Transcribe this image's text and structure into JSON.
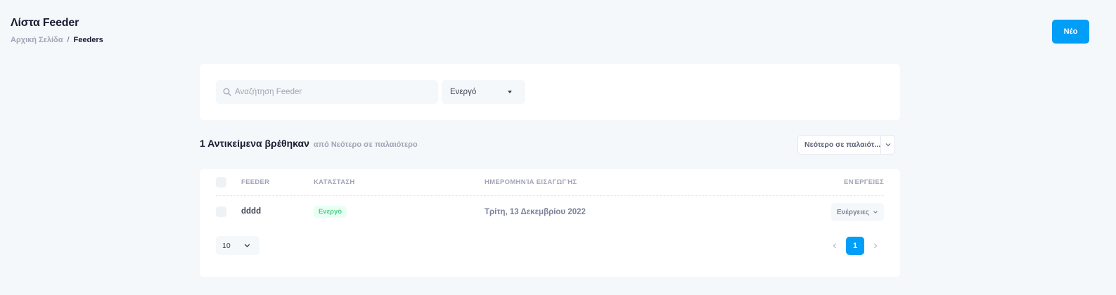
{
  "header": {
    "title": "Λίστα Feeder",
    "breadcrumb": {
      "home": "Αρχική Σελίδα",
      "separator": "/",
      "current": "Feeders"
    },
    "new_button": "Νέο"
  },
  "filters": {
    "search_placeholder": "Αναζήτηση Feeder",
    "search_value": "",
    "status_selected": "Ενεργό"
  },
  "results": {
    "count_text": "1 Αντικείμενα βρέθηκαν",
    "sort_text": "από Νεότερο σε παλαιότερο",
    "sort_select_label": "Νεότερο σε παλαιότ..."
  },
  "table": {
    "columns": [
      "FEEDER",
      "ΚΑΤΆΣΤΑΣΗ",
      "ΗΜΕΡΟΜΗΝΊΑ ΕΙΣΑΓΩΓΉΣ",
      "ΕΝΈΡΓΕΙΕΣ"
    ],
    "rows": [
      {
        "name": "dddd",
        "status": "Ενεργό",
        "date": "Τρίτη, 13 Δεκεμβρίου 2022",
        "actions_label": "Ενέργειες"
      }
    ]
  },
  "pagination": {
    "page_size": "10",
    "current_page": "1"
  },
  "colors": {
    "primary": "#009ef7",
    "success_text": "#50cd89",
    "success_bg": "#e8fff3",
    "page_bg": "#f5f8fa"
  },
  "icons": [
    "search-icon",
    "caret-down-icon",
    "chevron-down-icon",
    "chevron-left-icon",
    "chevron-right-icon"
  ]
}
